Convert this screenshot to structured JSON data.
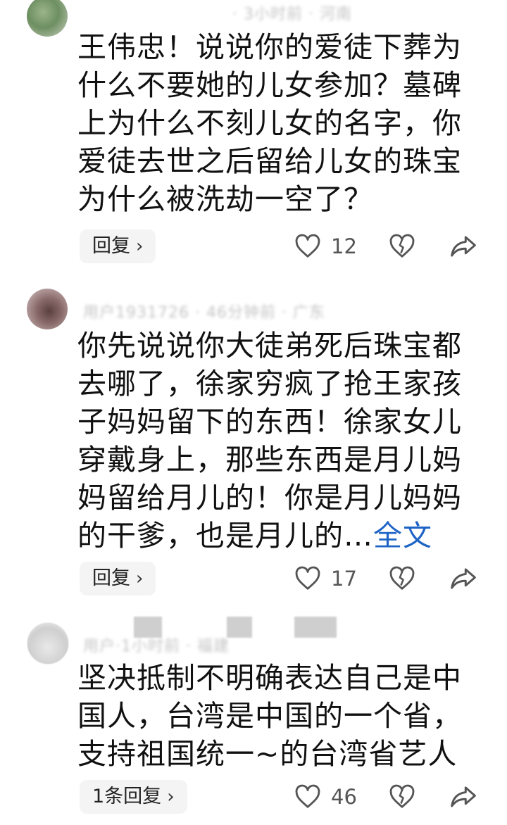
{
  "comments": [
    {
      "meta": "· 3小时前 · 河南",
      "text": "王伟忠！说说你的爱徒下葬为什么不要她的儿女参加？墓碑上为什么不刻儿女的名字，你爱徒去世之后留给儿女的珠宝为什么被洗劫一空了？",
      "more": "",
      "reply_label": "回复",
      "likes": "12"
    },
    {
      "meta": "用户1931726 · 46分钟前 · 广东",
      "text": "你先说说你大徒弟死后珠宝都去哪了，徐家穷疯了抢王家孩子妈妈留下的东西！徐家女儿穿戴身上，那些东西是月儿妈妈留给月儿的！你是月儿妈妈的干爹，也是月儿的…",
      "more": "全文",
      "reply_label": "回复",
      "likes": "17"
    },
    {
      "meta": "用户·1小时前 · 福建",
      "text": "坚决抵制不明确表达自己是中国人，台湾是中国的一个省，支持祖国统一~的台湾省艺人",
      "more": "",
      "reply_label": "1条回复",
      "likes": "46"
    }
  ],
  "icons": {
    "like": "heart-outline-icon",
    "dislike": "broken-heart-icon",
    "share": "share-arrow-icon",
    "chevron": "chevron-right-icon"
  }
}
